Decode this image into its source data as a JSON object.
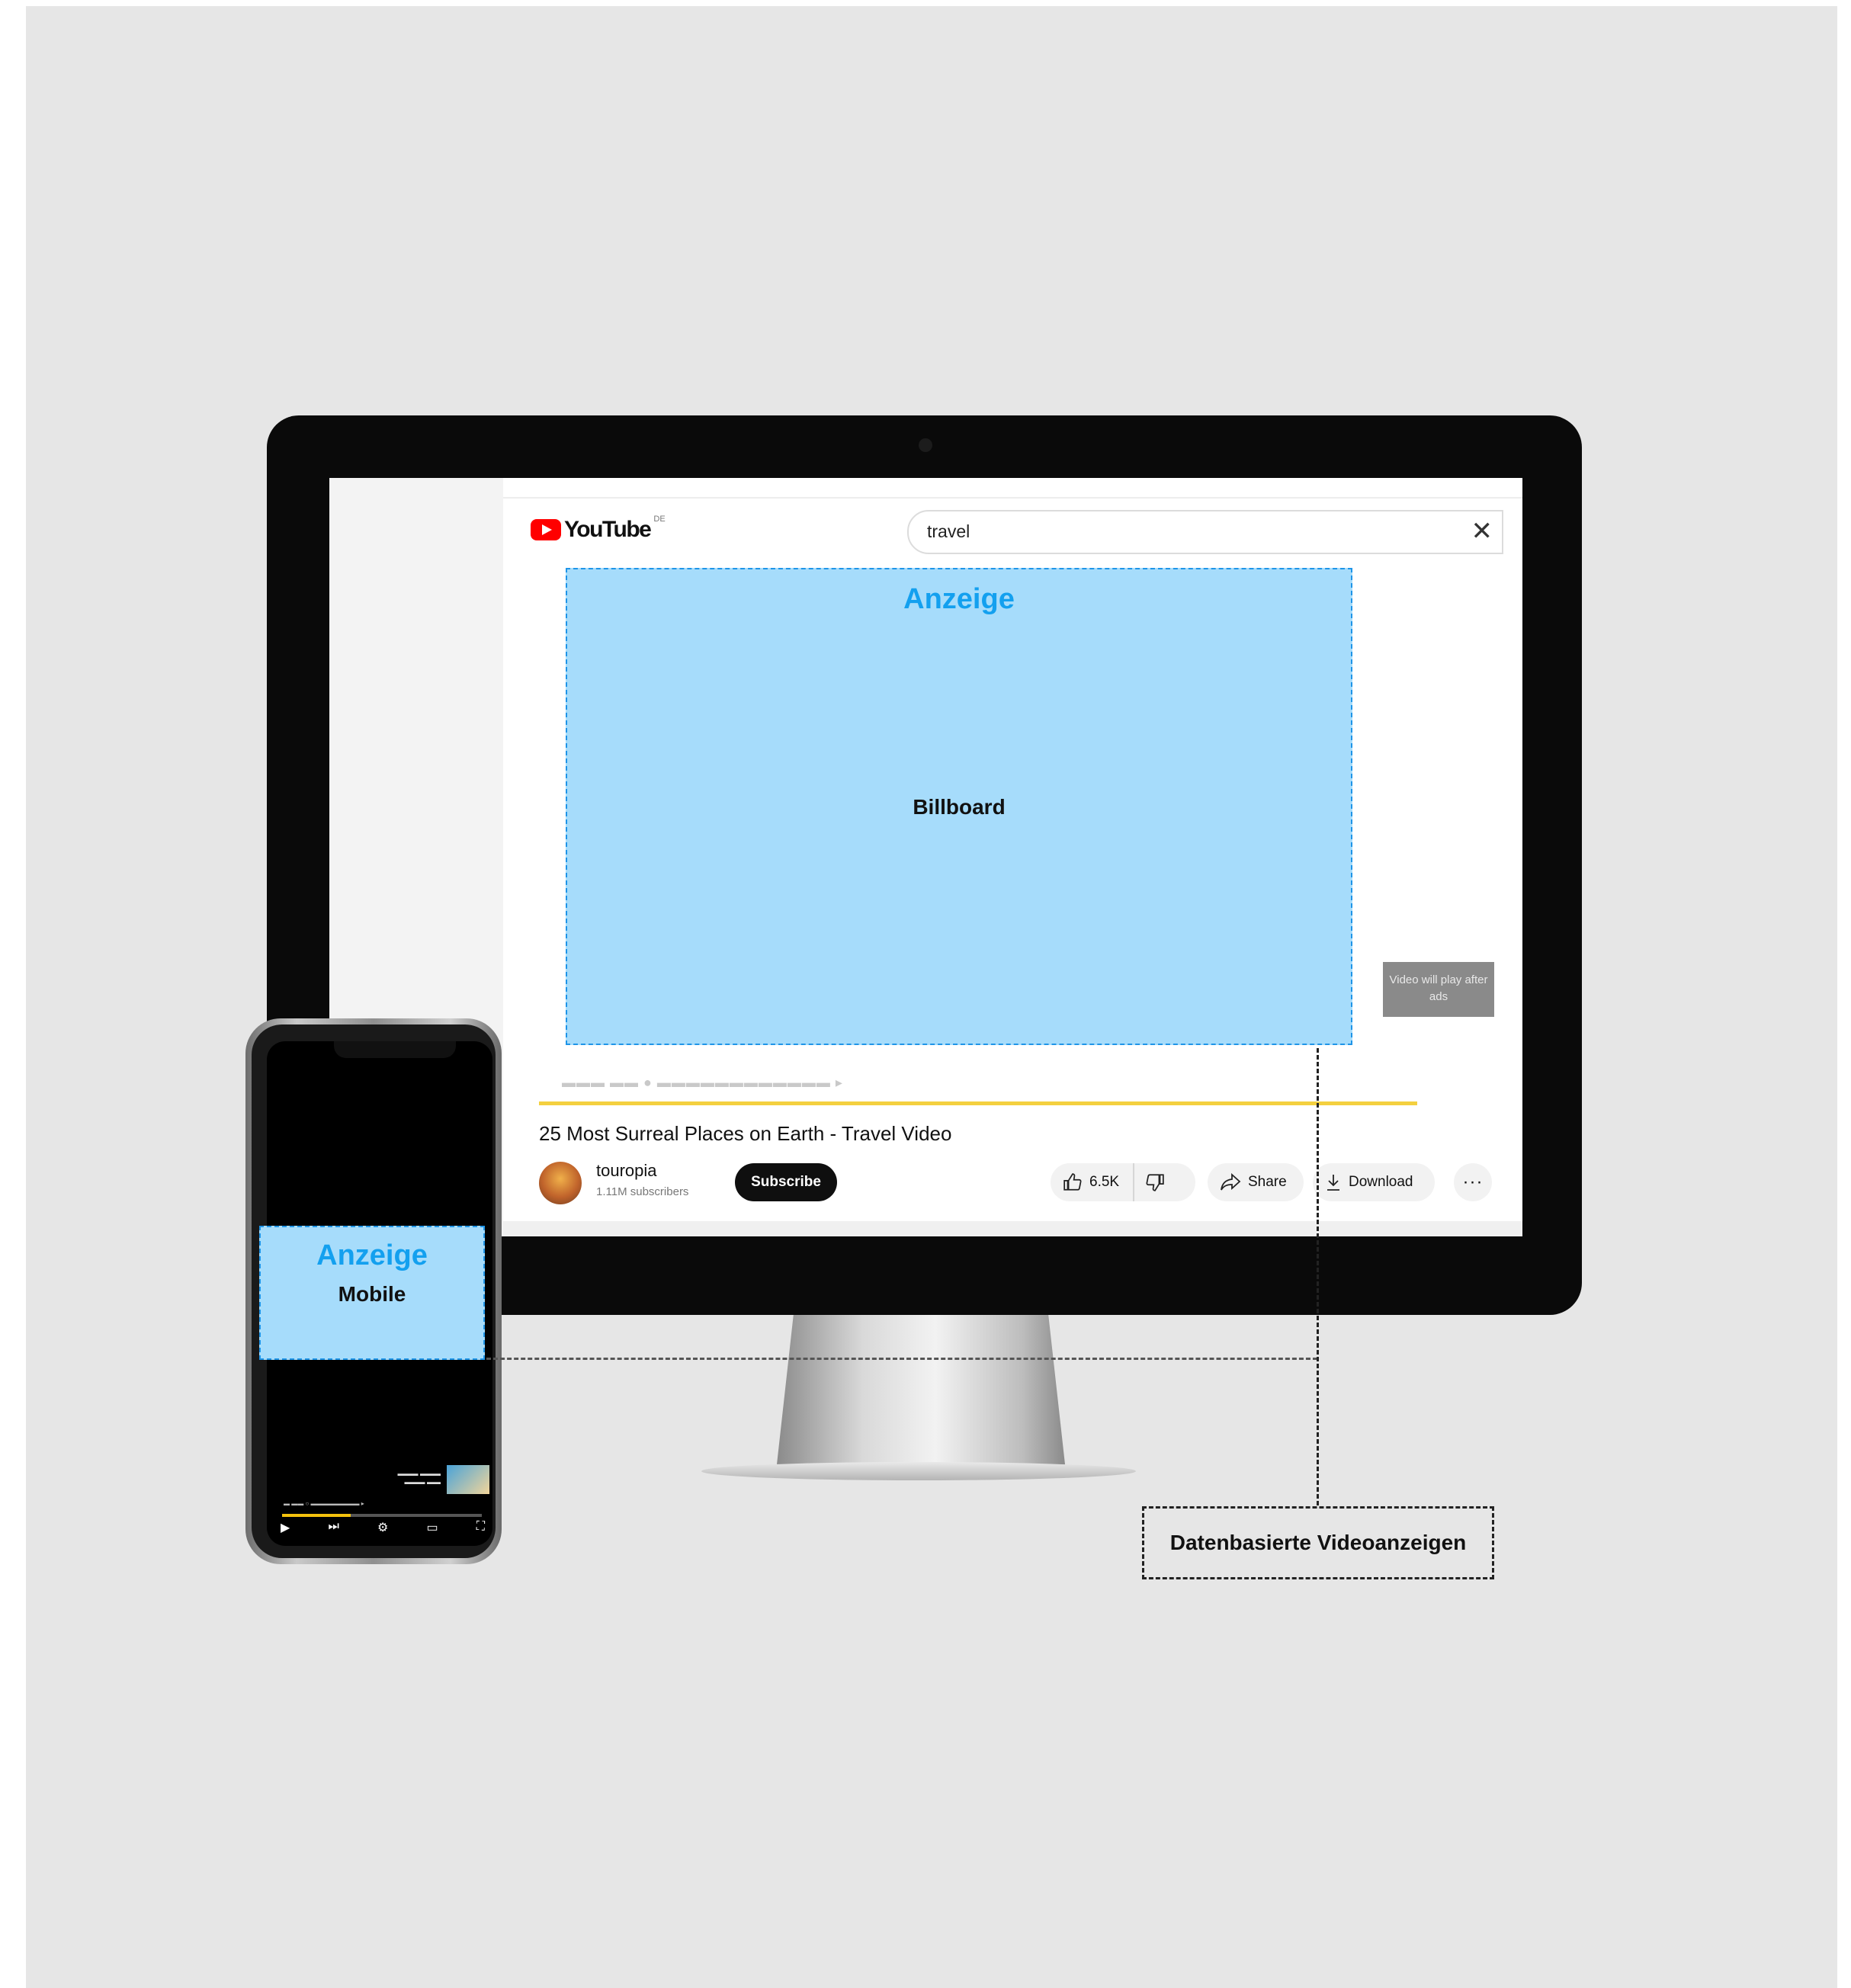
{
  "youtube": {
    "logo_text": "YouTube",
    "region": "DE",
    "search_query": "travel",
    "clear_symbol": "✕"
  },
  "billboard_ad": {
    "label": "Anzeige",
    "format": "Billboard"
  },
  "ad_notice": "Video will play after ads",
  "video": {
    "title": "25 Most Surreal Places on Earth - Travel Video",
    "channel": "touropia",
    "subscribers": "1.11M subscribers",
    "subscribe_label": "Subscribe",
    "likes": "6.5K",
    "share_label": "Share",
    "download_label": "Download",
    "more_label": "···"
  },
  "mobile_ad": {
    "label": "Anzeige",
    "format": "Mobile"
  },
  "callout": "Datenbasierte Videoanzeigen",
  "colors": {
    "ad_fill": "#a6dcfb",
    "ad_border": "#1f95e8",
    "ad_label": "#13a0ef",
    "progress": "#f4d03f",
    "youtube_red": "#ff0000"
  },
  "icons": [
    "youtube-logo-icon",
    "close-icon",
    "thumbs-up-icon",
    "thumbs-down-icon",
    "share-icon",
    "download-icon",
    "more-icon",
    "play-icon",
    "cast-icon",
    "fullscreen-icon"
  ]
}
